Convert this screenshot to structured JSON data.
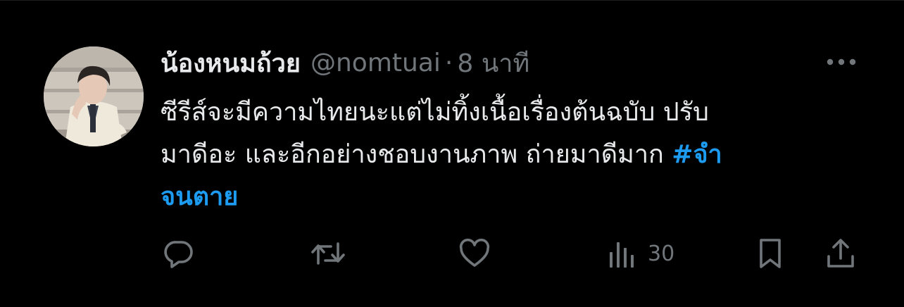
{
  "author": {
    "display_name": "น้องหนมถ้วย",
    "handle": "@nomtuai",
    "separator": "·",
    "time": "8 นาที"
  },
  "tweet": {
    "line1": "ซีรีส์จะมีความไทยนะแต่ไม่ทิ้งเนื้อเรื่องต้นฉบับ ปรับ",
    "line2_text": "มาดีอะ และอีกอย่างชอบงานภาพ ถ่ายมาดีมาก ",
    "line2_hashtag": "#จำ",
    "line3_hashtag": "จนตาย"
  },
  "actions": {
    "reply_icon": "reply-icon",
    "retweet_icon": "retweet-icon",
    "like_icon": "heart-icon",
    "views_icon": "views-icon",
    "views_count": "30",
    "bookmark_icon": "bookmark-icon",
    "share_icon": "share-icon",
    "more_icon": "more-icon"
  },
  "colors": {
    "background": "#000000",
    "text": "#e7e9ea",
    "muted": "#71767b",
    "link": "#1d9bf0"
  }
}
